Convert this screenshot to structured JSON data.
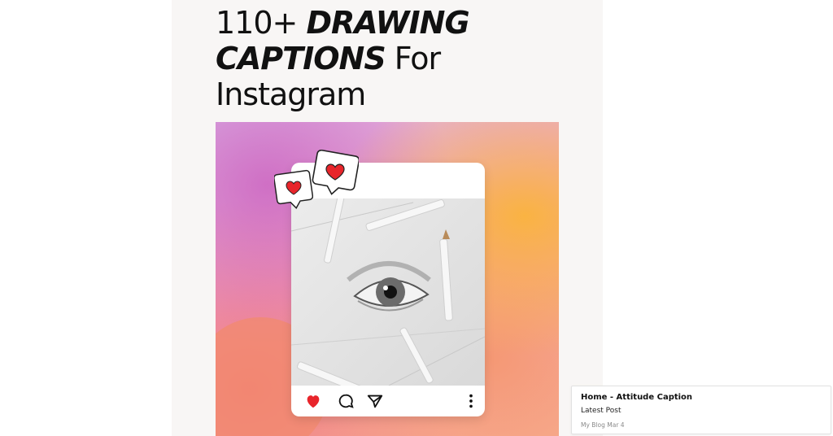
{
  "poster": {
    "headline": {
      "line1_plain": "110+ ",
      "line1_bold": "DRAWING",
      "line2_bold": "CAPTIONS",
      "line2_plain": " For",
      "line3": "Instagram"
    }
  },
  "post_card": {
    "icons": [
      "heart-icon",
      "comment-icon",
      "share-icon",
      "more-icon"
    ],
    "like_bubbles": 2
  },
  "colors": {
    "heart": "#e8252b",
    "headline": "#111111"
  },
  "notice": {
    "title": "Home - Attitude Caption",
    "subtitle": "Latest Post",
    "meta": "My  Blog  Mar  4"
  }
}
